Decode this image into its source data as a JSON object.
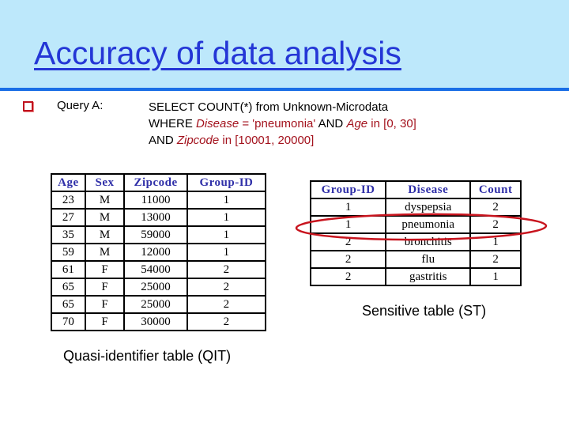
{
  "slide": {
    "title": "Accuracy of data analysis",
    "colors": {
      "header_band": "#bde8fb",
      "header_rule": "#1a6ee6",
      "title": "#2436d6",
      "highlight_red": "#a3121d",
      "table_header": "#2f2fa8"
    }
  },
  "query": {
    "bullet_icon": "hollow-square-bullet",
    "label": "Query A:",
    "line1": "SELECT COUNT(*) from Unknown-Microdata",
    "line2": {
      "where": "WHERE ",
      "disease_field": "Disease",
      "disease_cond": " = 'pneumonia'",
      "and1": " AND ",
      "age_field": "Age",
      "age_cond": " in [0, 30]"
    },
    "line3": {
      "and2": "AND ",
      "zip_field": "Zipcode",
      "zip_cond": " in [10001, 20000]"
    }
  },
  "qit": {
    "caption": "Quasi-identifier table (QIT)",
    "headers": [
      "Age",
      "Sex",
      "Zipcode",
      "Group-ID"
    ],
    "rows": [
      [
        "23",
        "M",
        "11000",
        "1"
      ],
      [
        "27",
        "M",
        "13000",
        "1"
      ],
      [
        "35",
        "M",
        "59000",
        "1"
      ],
      [
        "59",
        "M",
        "12000",
        "1"
      ],
      [
        "61",
        "F",
        "54000",
        "2"
      ],
      [
        "65",
        "F",
        "25000",
        "2"
      ],
      [
        "65",
        "F",
        "25000",
        "2"
      ],
      [
        "70",
        "F",
        "30000",
        "2"
      ]
    ]
  },
  "st": {
    "caption": "Sensitive table (ST)",
    "headers": [
      "Group-ID",
      "Disease",
      "Count"
    ],
    "rows": [
      [
        "1",
        "dyspepsia",
        "2"
      ],
      [
        "1",
        "pneumonia",
        "2"
      ],
      [
        "2",
        "bronchitis",
        "1"
      ],
      [
        "2",
        "flu",
        "2"
      ],
      [
        "2",
        "gastritis",
        "1"
      ]
    ],
    "highlighted_row_index": 1
  }
}
